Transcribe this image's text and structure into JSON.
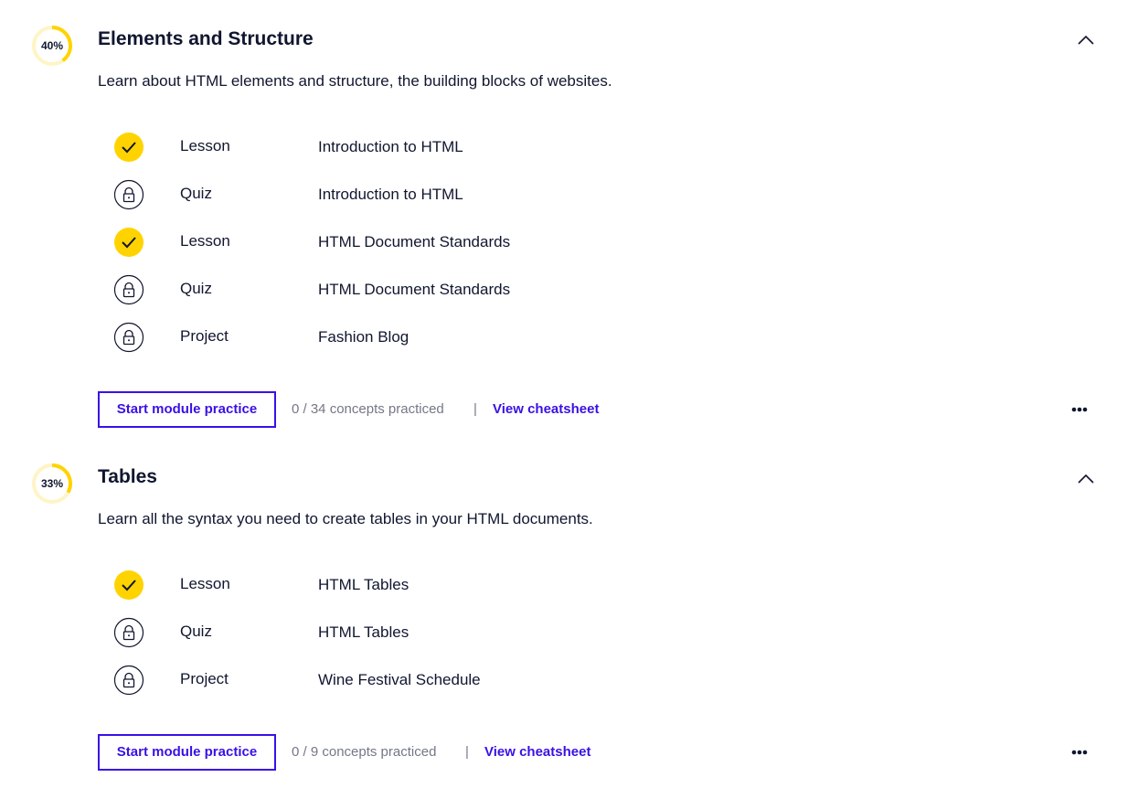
{
  "modules": [
    {
      "progress_label": "40%",
      "progress_fraction": 0.4,
      "title": "Elements and Structure",
      "description": "Learn about HTML elements and structure, the building blocks of websites.",
      "items": [
        {
          "type": "Lesson",
          "name": "Introduction to HTML",
          "status": "completed",
          "icon": "checkmark-icon"
        },
        {
          "type": "Quiz",
          "name": "Introduction to HTML",
          "status": "locked",
          "icon": "lock-icon"
        },
        {
          "type": "Lesson",
          "name": "HTML Document Standards",
          "status": "completed",
          "icon": "checkmark-icon"
        },
        {
          "type": "Quiz",
          "name": "HTML Document Standards",
          "status": "locked",
          "icon": "lock-icon"
        },
        {
          "type": "Project",
          "name": "Fashion Blog",
          "status": "locked",
          "icon": "lock-icon"
        }
      ],
      "practice_button": "Start module practice",
      "concepts_text": "0 / 34 concepts practiced",
      "divider": "|",
      "cheatsheet_link": "View cheatsheet"
    },
    {
      "progress_label": "33%",
      "progress_fraction": 0.33,
      "title": "Tables",
      "description": "Learn all the syntax you need to create tables in your HTML documents.",
      "items": [
        {
          "type": "Lesson",
          "name": "HTML Tables",
          "status": "completed",
          "icon": "checkmark-icon"
        },
        {
          "type": "Quiz",
          "name": "HTML Tables",
          "status": "locked",
          "icon": "lock-icon"
        },
        {
          "type": "Project",
          "name": "Wine Festival Schedule",
          "status": "locked",
          "icon": "lock-icon"
        }
      ],
      "practice_button": "Start module practice",
      "concepts_text": "0 / 9 concepts practiced",
      "divider": "|",
      "cheatsheet_link": "View cheatsheet"
    }
  ],
  "icons": {
    "collapse": "chevron-up-icon",
    "more": "more-options-icon"
  },
  "colors": {
    "accent": "#3a10e5",
    "progress": "#ffd300",
    "progress_track": "#fff4c6",
    "text": "#10162f",
    "muted": "#747887"
  }
}
